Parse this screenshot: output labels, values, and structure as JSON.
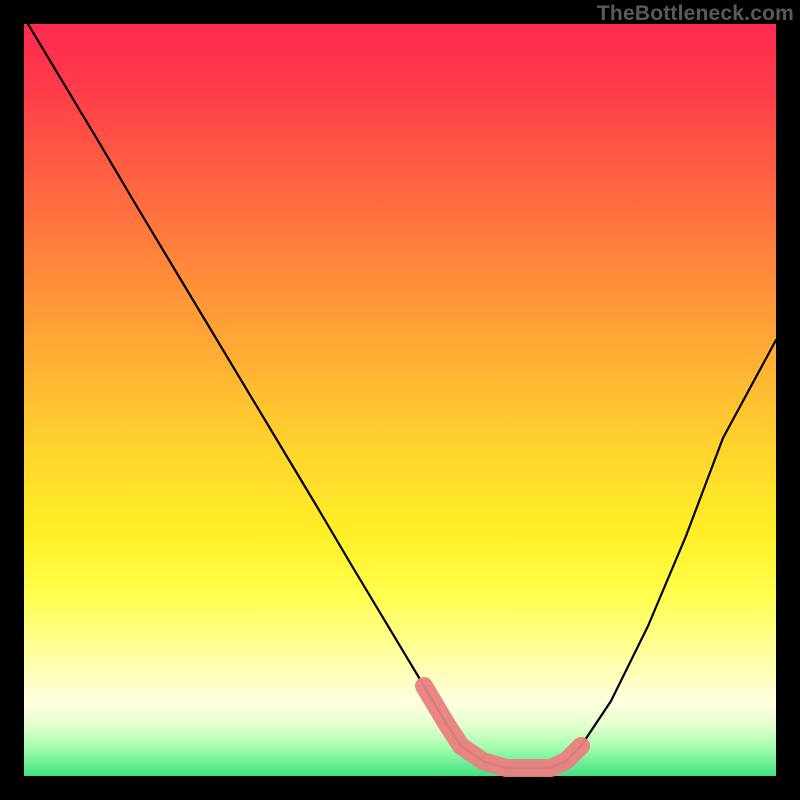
{
  "watermark": "TheBottleneck.com",
  "chart_data": {
    "type": "line",
    "title": "",
    "xlabel": "",
    "ylabel": "",
    "xlim": [
      0,
      100
    ],
    "ylim": [
      0,
      100
    ],
    "series": [
      {
        "name": "bottleneck-curve",
        "color": "#000000",
        "x": [
          0,
          5,
          10,
          15,
          20,
          25,
          30,
          35,
          40,
          45,
          50,
          55,
          58,
          60,
          63,
          66,
          69,
          72,
          74,
          76,
          80,
          85,
          90,
          95,
          100
        ],
        "y": [
          100,
          92,
          84,
          76,
          68,
          60,
          52,
          44,
          36,
          28,
          20,
          12,
          7,
          4,
          2,
          1,
          1,
          1,
          2,
          4,
          10,
          20,
          32,
          45,
          58
        ]
      },
      {
        "name": "highlight-band",
        "color": "#e98080",
        "x": [
          55,
          58,
          60,
          63,
          66,
          69,
          72,
          74,
          76
        ],
        "y": [
          12,
          7,
          4,
          2,
          1,
          1,
          1,
          2,
          4
        ]
      }
    ],
    "annotations": []
  }
}
